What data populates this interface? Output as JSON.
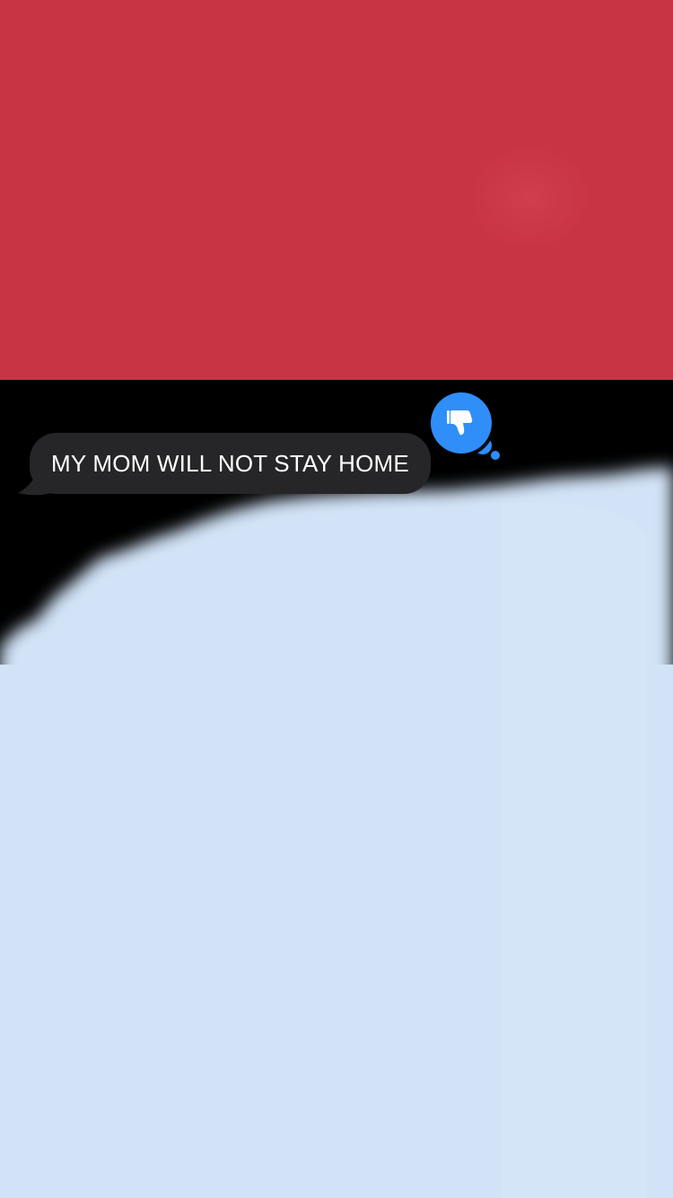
{
  "message": {
    "text": "MY MOM WILL NOT STAY HOME",
    "bubble_color": "#262628",
    "text_color": "#ffffff"
  },
  "reaction": {
    "icon": "thumbs-down-icon",
    "color": "#2f8ef7"
  },
  "background": {
    "top_color": "#c83444",
    "middle_color": "#000000",
    "bottom_color": "#d2e3f7"
  }
}
